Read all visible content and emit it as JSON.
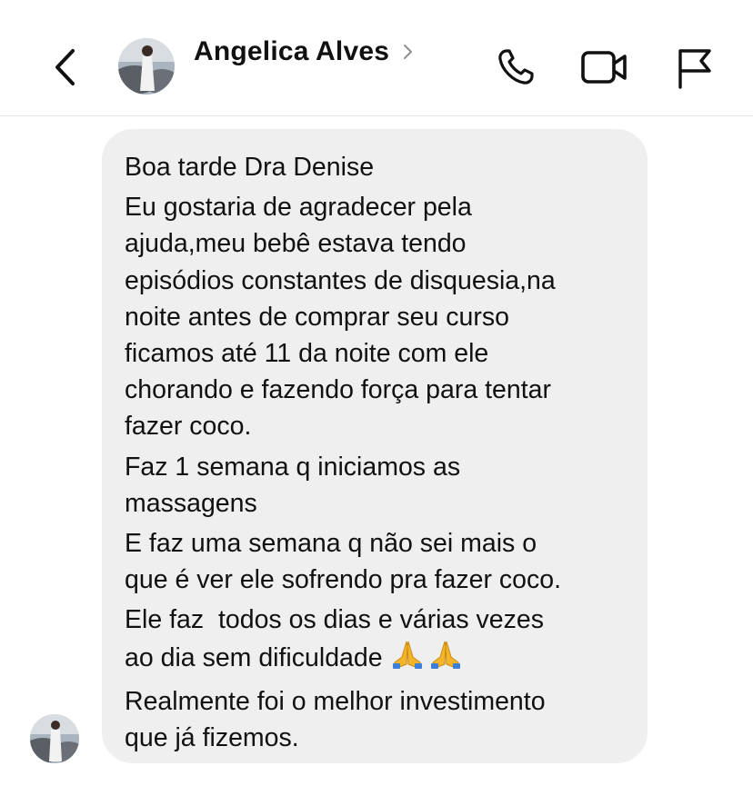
{
  "header": {
    "contact_name": "Angelica Alves",
    "icons": {
      "back": "chevron-left-icon",
      "details": "chevron-right-icon",
      "call": "phone-icon",
      "video": "video-camera-icon",
      "report": "flag-icon"
    }
  },
  "message": {
    "paragraphs": [
      [
        "Boa tarde Dra Denise"
      ],
      [
        "Eu gostaria de agradecer pela",
        "ajuda,meu bebê estava tendo",
        "episódios constantes de disquesia,na",
        "noite antes de comprar seu curso",
        "ficamos até 11 da noite com ele",
        "chorando e fazendo força para tentar",
        "fazer coco."
      ],
      [
        "Faz 1 semana q iniciamos as",
        "massagens"
      ],
      [
        "E faz uma semana q não sei mais o",
        "que é ver ele sofrendo pra fazer coco."
      ],
      [
        "Ele faz  todos os dias e várias vezes",
        "ao dia sem dificuldade"
      ],
      [
        "Realmente foi o melhor investimento",
        "que já fizemos."
      ]
    ],
    "emoji": "folded-hands-icon"
  },
  "colors": {
    "bubble": "#efefef",
    "divider": "#e4e4e4",
    "text": "#111111",
    "emoji": "#f5b52a"
  }
}
